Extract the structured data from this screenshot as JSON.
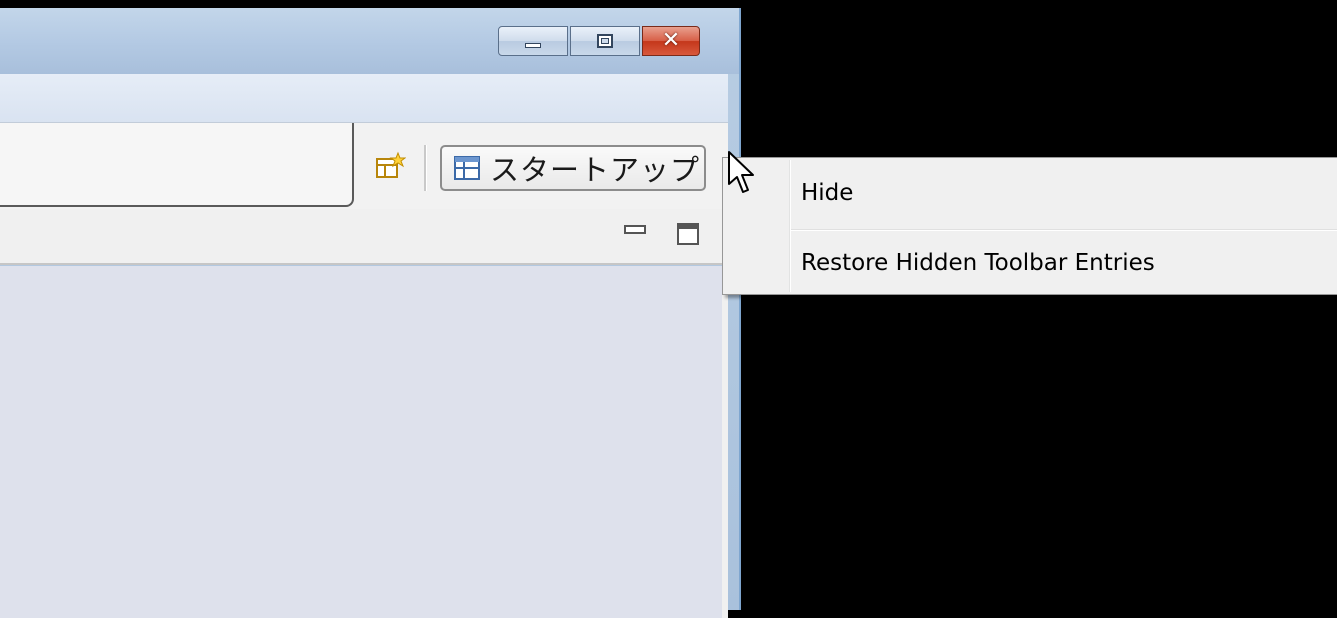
{
  "window": {
    "controls": {
      "minimize_icon": "minimize-icon",
      "maximize_icon": "maximize-icon",
      "close_icon": "close-icon",
      "close_glyph": "✕",
      "close_color": "#c4371b"
    }
  },
  "toolbar": {
    "open_perspective_icon": "open-perspective-icon",
    "perspective_button": {
      "icon": "perspective-icon",
      "label": "スタートアップ"
    }
  },
  "view": {
    "minimize_icon": "view-minimize-icon",
    "maximize_icon": "view-maximize-icon"
  },
  "context_menu": {
    "items": [
      {
        "label": "Hide"
      },
      {
        "label": "Restore Hidden Toolbar Entries"
      }
    ]
  },
  "cursor": {
    "icon": "mouse-pointer-icon"
  },
  "colors": {
    "desktop_background": "#000000",
    "window_frame": "#b3c9e3",
    "view_body": "#dee1ec",
    "menu_background": "#f0f0f0"
  }
}
